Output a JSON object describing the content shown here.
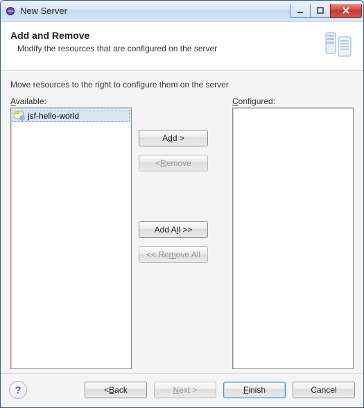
{
  "window": {
    "title": "New Server"
  },
  "banner": {
    "heading": "Add and Remove",
    "subheading": "Modify the resources that are configured on the server"
  },
  "content": {
    "instruction": "Move resources to the right to configure them on the server",
    "available_label_pre": "",
    "available_label_mn": "A",
    "available_label_post": "vailable:",
    "configured_label_pre": "",
    "configured_label_mn": "C",
    "configured_label_post": "onfigured:",
    "available_items": [
      {
        "name": "jsf-hello-world"
      }
    ],
    "configured_items": []
  },
  "buttons": {
    "add_pre": "A",
    "add_mn": "d",
    "add_post": "d >",
    "remove_pre": "< ",
    "remove_mn": "R",
    "remove_post": "emove",
    "addall_pre": "Add A",
    "addall_mn": "l",
    "addall_post": "l >>",
    "removeall_pre": "<< Re",
    "removeall_mn": "m",
    "removeall_post": "ove All"
  },
  "footer": {
    "help": "?",
    "back_pre": "< ",
    "back_mn": "B",
    "back_post": "ack",
    "next_pre": "",
    "next_mn": "N",
    "next_post": "ext >",
    "finish_pre": "",
    "finish_mn": "F",
    "finish_post": "inish",
    "cancel": "Cancel"
  }
}
